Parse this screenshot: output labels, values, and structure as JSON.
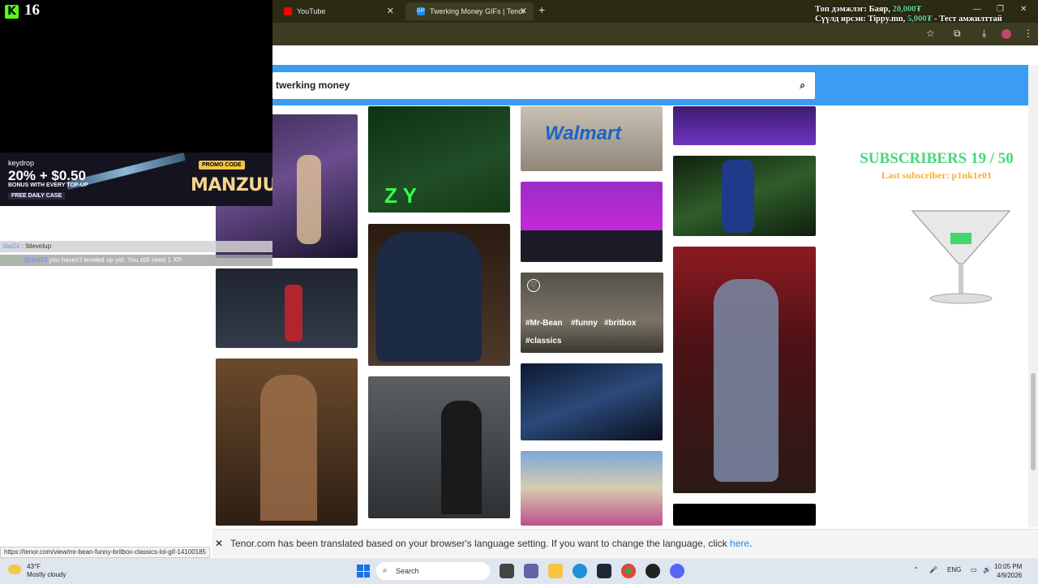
{
  "browser": {
    "tabs": [
      {
        "label": "YouTube",
        "active": false
      },
      {
        "label": "Twerking Money GIFs | Tenor",
        "active": true
      }
    ],
    "new_tab_symbol": "+",
    "status_url": "https://tenor.com/view/mr-bean-funny-britbox-classics-lol-gif-14100185"
  },
  "stream_overlay": {
    "kick_viewers": "16",
    "donation_line1_label": "Топ дэмжлэг: Баяр, ",
    "donation_line1_amount": "20,000₮",
    "donation_line2_label": "Сүүлд ирсэн: Tippy.mn, ",
    "donation_line2_amount": "5,000₮",
    "donation_line2_suffix": " - Тест амжилттай",
    "promo": {
      "brand": "keydrop",
      "headline": "20% + $0.50",
      "bonus": "BONUS WITH EVERY TOP-UP",
      "daily": "FREE DAILY CASE",
      "code_label": "PROMO CODE",
      "code": "MANZUUL"
    },
    "chat": [
      {
        "user": "dlai24",
        "text": " : !blevelup"
      },
      {
        "user": "BotRix",
        "mention": "@dlai24",
        "text": " you haven't leveled up yet. You still need 1 XP."
      }
    ],
    "subscribers_title": "SUBSCRIBERS 19 / 50",
    "last_subscriber": "Last subscriber: p1nk1e01"
  },
  "tenor": {
    "search_value": "twerking money",
    "gif_tags": [
      "#Mr-Bean",
      "#funny",
      "#britbox",
      "#classics"
    ],
    "translation_notice": "Tenor.com has been translated based on your browser's language setting. If you want to change the language, click ",
    "translation_link": "here",
    "translation_end": "."
  },
  "taskbar": {
    "temperature": "43°F",
    "weather": "Mostly cloudy",
    "search_placeholder": "Search",
    "language": "ENG",
    "time": "10:05 PM",
    "date": "4/9/2026"
  },
  "colors": {
    "tenor_blue": "#3b9cf4",
    "kick_green": "#53fc18",
    "subs_green": "#4ad47a",
    "subs_orange": "#f4b133"
  }
}
